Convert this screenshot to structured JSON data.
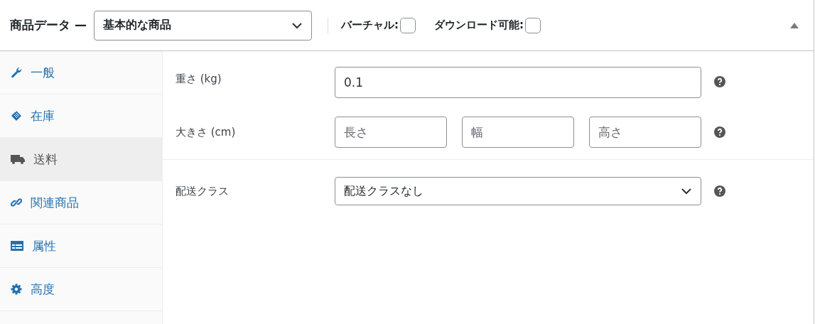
{
  "header": {
    "title": "商品データ —",
    "product_type": "基本的な商品",
    "options": [
      {
        "label": "バーチャル:",
        "checked": false
      },
      {
        "label": "ダウンロード可能:",
        "checked": false
      }
    ]
  },
  "tabs": [
    {
      "kind": "wrench",
      "label": "一般",
      "selected": false
    },
    {
      "kind": "tag",
      "label": "在庫",
      "selected": false
    },
    {
      "kind": "truck",
      "label": "送料",
      "selected": true
    },
    {
      "kind": "link",
      "label": "関連商品",
      "selected": false
    },
    {
      "kind": "table",
      "label": "属性",
      "selected": false
    },
    {
      "kind": "gear",
      "label": "高度",
      "selected": false
    }
  ],
  "fields": {
    "weight": {
      "label": "重さ (kg)",
      "value": "0.1"
    },
    "dimensions": {
      "label": "大きさ (cm)",
      "placeholders": [
        "長さ",
        "幅",
        "高さ"
      ]
    },
    "shipping_class": {
      "label": "配送クラス",
      "value": "配送クラスなし"
    }
  }
}
